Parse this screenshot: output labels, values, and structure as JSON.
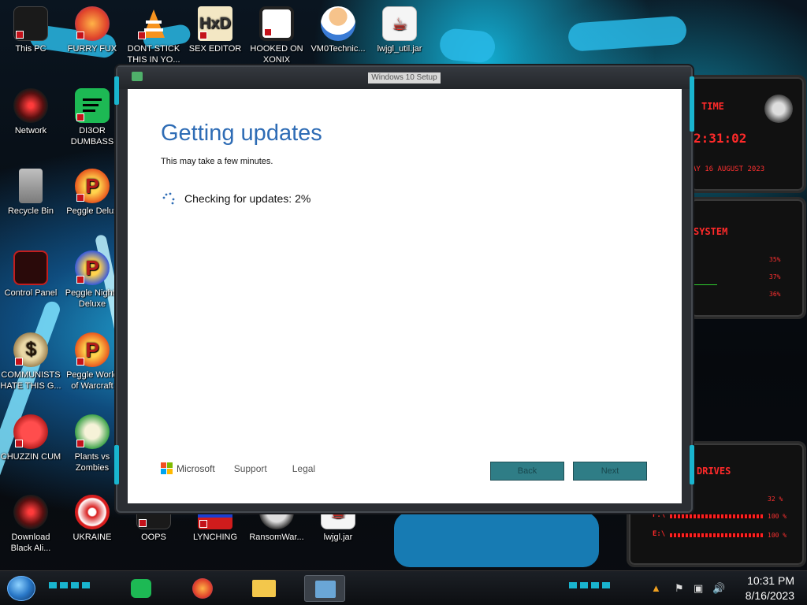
{
  "desktop": {
    "icons": [
      {
        "label": "This PC"
      },
      {
        "label": "FURRY FUX"
      },
      {
        "label": "DONT STICK THIS IN YO..."
      },
      {
        "label": "SEX EDITOR"
      },
      {
        "label": "HOOKED ON XONIX"
      },
      {
        "label": "VM0Technic..."
      },
      {
        "label": "lwjgl_util.jar"
      },
      {
        "label": "Network"
      },
      {
        "label": "DI3OR DUMBASS"
      },
      {
        "label": "Recycle Bin"
      },
      {
        "label": "Peggle Delux"
      },
      {
        "label": "Control Panel"
      },
      {
        "label": "Peggle Nights Deluxe"
      },
      {
        "label": "COMMUNISTS HATE THIS G..."
      },
      {
        "label": "Peggle World of Warcraft"
      },
      {
        "label": "CHUZZIN CUM"
      },
      {
        "label": "Plants vs Zombies"
      },
      {
        "label": "Download Black Ali..."
      },
      {
        "label": "UKRAINE"
      },
      {
        "label": "OOPS"
      },
      {
        "label": "LYNCHING"
      },
      {
        "label": "RansomWar..."
      },
      {
        "label": "lwjgl.jar"
      }
    ]
  },
  "widgets": {
    "time_title": "TIME",
    "time_value": "2:31:02",
    "date_value": "AY 16 AUGUST 2023",
    "system_title": "SYSTEM",
    "system_values": [
      "35%",
      "37%",
      "36%"
    ],
    "drives_title": "DRIVES",
    "drive_values": [
      "32 %",
      "100 %",
      "100 %"
    ],
    "drive_letters": [
      "F:\\",
      "E:\\"
    ]
  },
  "setup": {
    "window_title": "Windows 10 Setup",
    "heading": "Getting updates",
    "subtitle": "This may take a few minutes.",
    "status": "Checking for updates: 2%",
    "brand": "Microsoft",
    "support_link": "Support",
    "legal_link": "Legal",
    "back_label": "Back",
    "next_label": "Next"
  },
  "taskbar": {
    "time": "10:31 PM",
    "date": "8/16/2023"
  },
  "colors": {
    "heading_blue": "#2e6cb5",
    "button_teal": "#2f7d86",
    "accent_cyan": "#19b5cf",
    "widget_red": "#ff2a2a"
  }
}
